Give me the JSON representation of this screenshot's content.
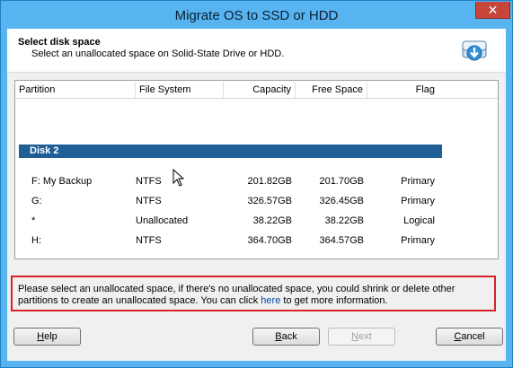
{
  "window": {
    "title": "Migrate OS to SSD or HDD",
    "close_glyph": "✕"
  },
  "header": {
    "title": "Select disk space",
    "subtitle": "Select an unallocated space on Solid-State Drive or HDD.",
    "icon": "disk-migrate-icon"
  },
  "table": {
    "columns": [
      "Partition",
      "File System",
      "Capacity",
      "Free Space",
      "Flag"
    ],
    "disk_label": "Disk 2",
    "rows": [
      {
        "partition": "F:  My Backup",
        "fs": "NTFS",
        "capacity": "201.82GB",
        "free": "201.70GB",
        "flag": "Primary"
      },
      {
        "partition": "G:",
        "fs": "NTFS",
        "capacity": "326.57GB",
        "free": "326.45GB",
        "flag": "Primary"
      },
      {
        "partition": "*",
        "fs": "Unallocated",
        "capacity": "38.22GB",
        "free": "38.22GB",
        "flag": "Logical"
      },
      {
        "partition": "H:",
        "fs": "NTFS",
        "capacity": "364.70GB",
        "free": "364.57GB",
        "flag": "Primary"
      }
    ]
  },
  "info": {
    "text_before": "Please select an unallocated space, if there's no unallocated space, you could shrink or delete other partitions to create an unallocated space. You can click ",
    "link": "here",
    "text_after": " to get more information."
  },
  "buttons": {
    "help_hotkey": "H",
    "help_rest": "elp",
    "back_hotkey": "B",
    "back_rest": "ack",
    "next_hotkey": "N",
    "next_rest": "ext",
    "cancel_hotkey": "C",
    "cancel_rest": "ancel"
  },
  "colors": {
    "title_bar": "#57b4f0",
    "disk_bar": "#1f5f96",
    "highlight_border": "#d8232a",
    "close": "#c7463a"
  }
}
